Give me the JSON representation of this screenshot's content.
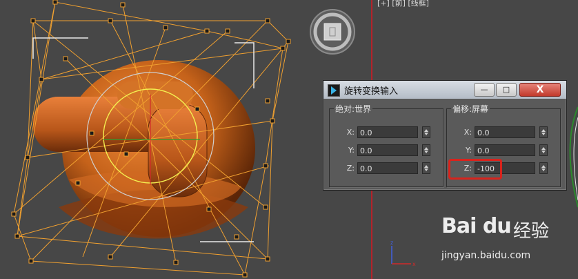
{
  "viewport_right": {
    "label": "[+] [前] [线框]"
  },
  "dialog": {
    "title": "旋转变换输入",
    "buttons": {
      "minimize": "—",
      "maximize": "□",
      "close": "X"
    },
    "absolute_group": {
      "title": "绝对:世界",
      "rows": [
        {
          "axis": "X:",
          "value": "0.0"
        },
        {
          "axis": "Y:",
          "value": "0.0"
        },
        {
          "axis": "Z:",
          "value": "0.0"
        }
      ]
    },
    "offset_group": {
      "title": "偏移:屏幕",
      "rows": [
        {
          "axis": "X:",
          "value": "0.0"
        },
        {
          "axis": "Y:",
          "value": "0.0"
        },
        {
          "axis": "Z:",
          "value": "-100"
        }
      ]
    }
  },
  "watermark": {
    "brand": "Bai du",
    "sub": "经验",
    "url": "jingyan.baidu.com"
  },
  "colors": {
    "model": "#c5621a",
    "wire": "#f0a030",
    "highlight": "#d9231c",
    "viewport_border": "#b4232a"
  }
}
